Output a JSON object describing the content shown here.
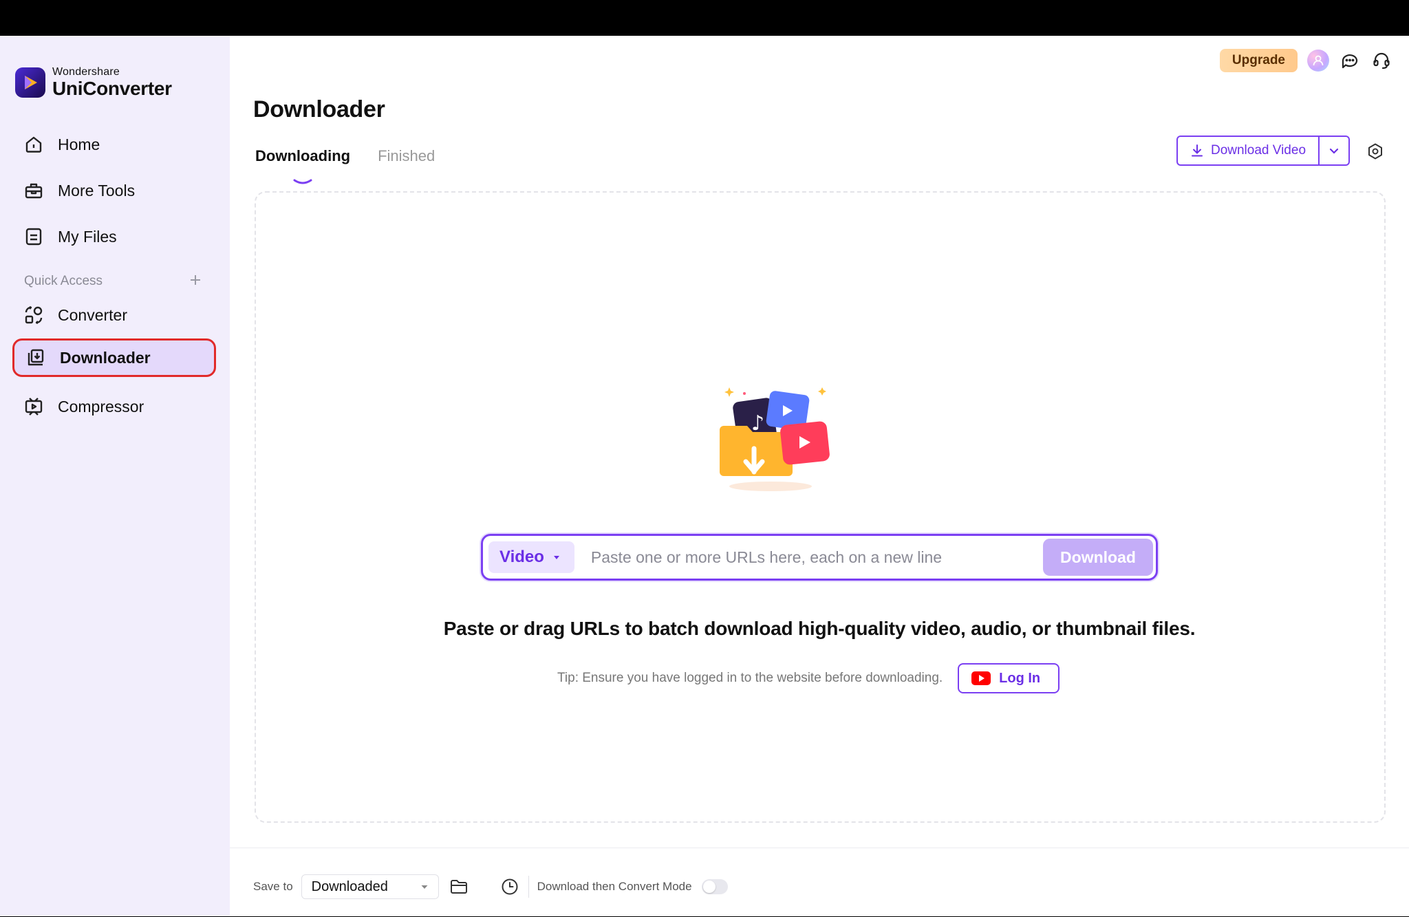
{
  "brand": {
    "small": "Wondershare",
    "name": "UniConverter"
  },
  "sidebar": {
    "items": [
      {
        "label": "Home",
        "icon": "home-icon"
      },
      {
        "label": "More Tools",
        "icon": "toolbox-icon"
      },
      {
        "label": "My Files",
        "icon": "file-icon"
      }
    ],
    "quick_access_label": "Quick Access",
    "quick_items": [
      {
        "label": "Converter",
        "icon": "converter-icon"
      },
      {
        "label": "Downloader",
        "icon": "downloader-icon",
        "active": true
      },
      {
        "label": "Compressor",
        "icon": "compressor-icon"
      }
    ]
  },
  "header": {
    "upgrade_label": "Upgrade"
  },
  "page": {
    "title": "Downloader",
    "tabs": [
      {
        "label": "Downloading",
        "active": true
      },
      {
        "label": "Finished",
        "active": false
      }
    ],
    "download_video_label": "Download Video"
  },
  "url_bar": {
    "type_label": "Video",
    "placeholder": "Paste one or more URLs here, each on a new line",
    "value": "",
    "button_label": "Download"
  },
  "headline": "Paste or drag URLs to batch download high-quality video, audio, or thumbnail files.",
  "tip": {
    "text": "Tip: Ensure you have logged in to the website before downloading.",
    "login_label": "Log In"
  },
  "footer": {
    "save_label": "Save to",
    "save_value": "Downloaded",
    "convert_mode_label": "Download then Convert Mode",
    "convert_mode_on": false
  },
  "colors": {
    "accent": "#7b3ff2",
    "active_outline": "#e12a2a",
    "sidebar_bg": "#f2eefc",
    "upgrade_bg": "#ffc98c"
  }
}
